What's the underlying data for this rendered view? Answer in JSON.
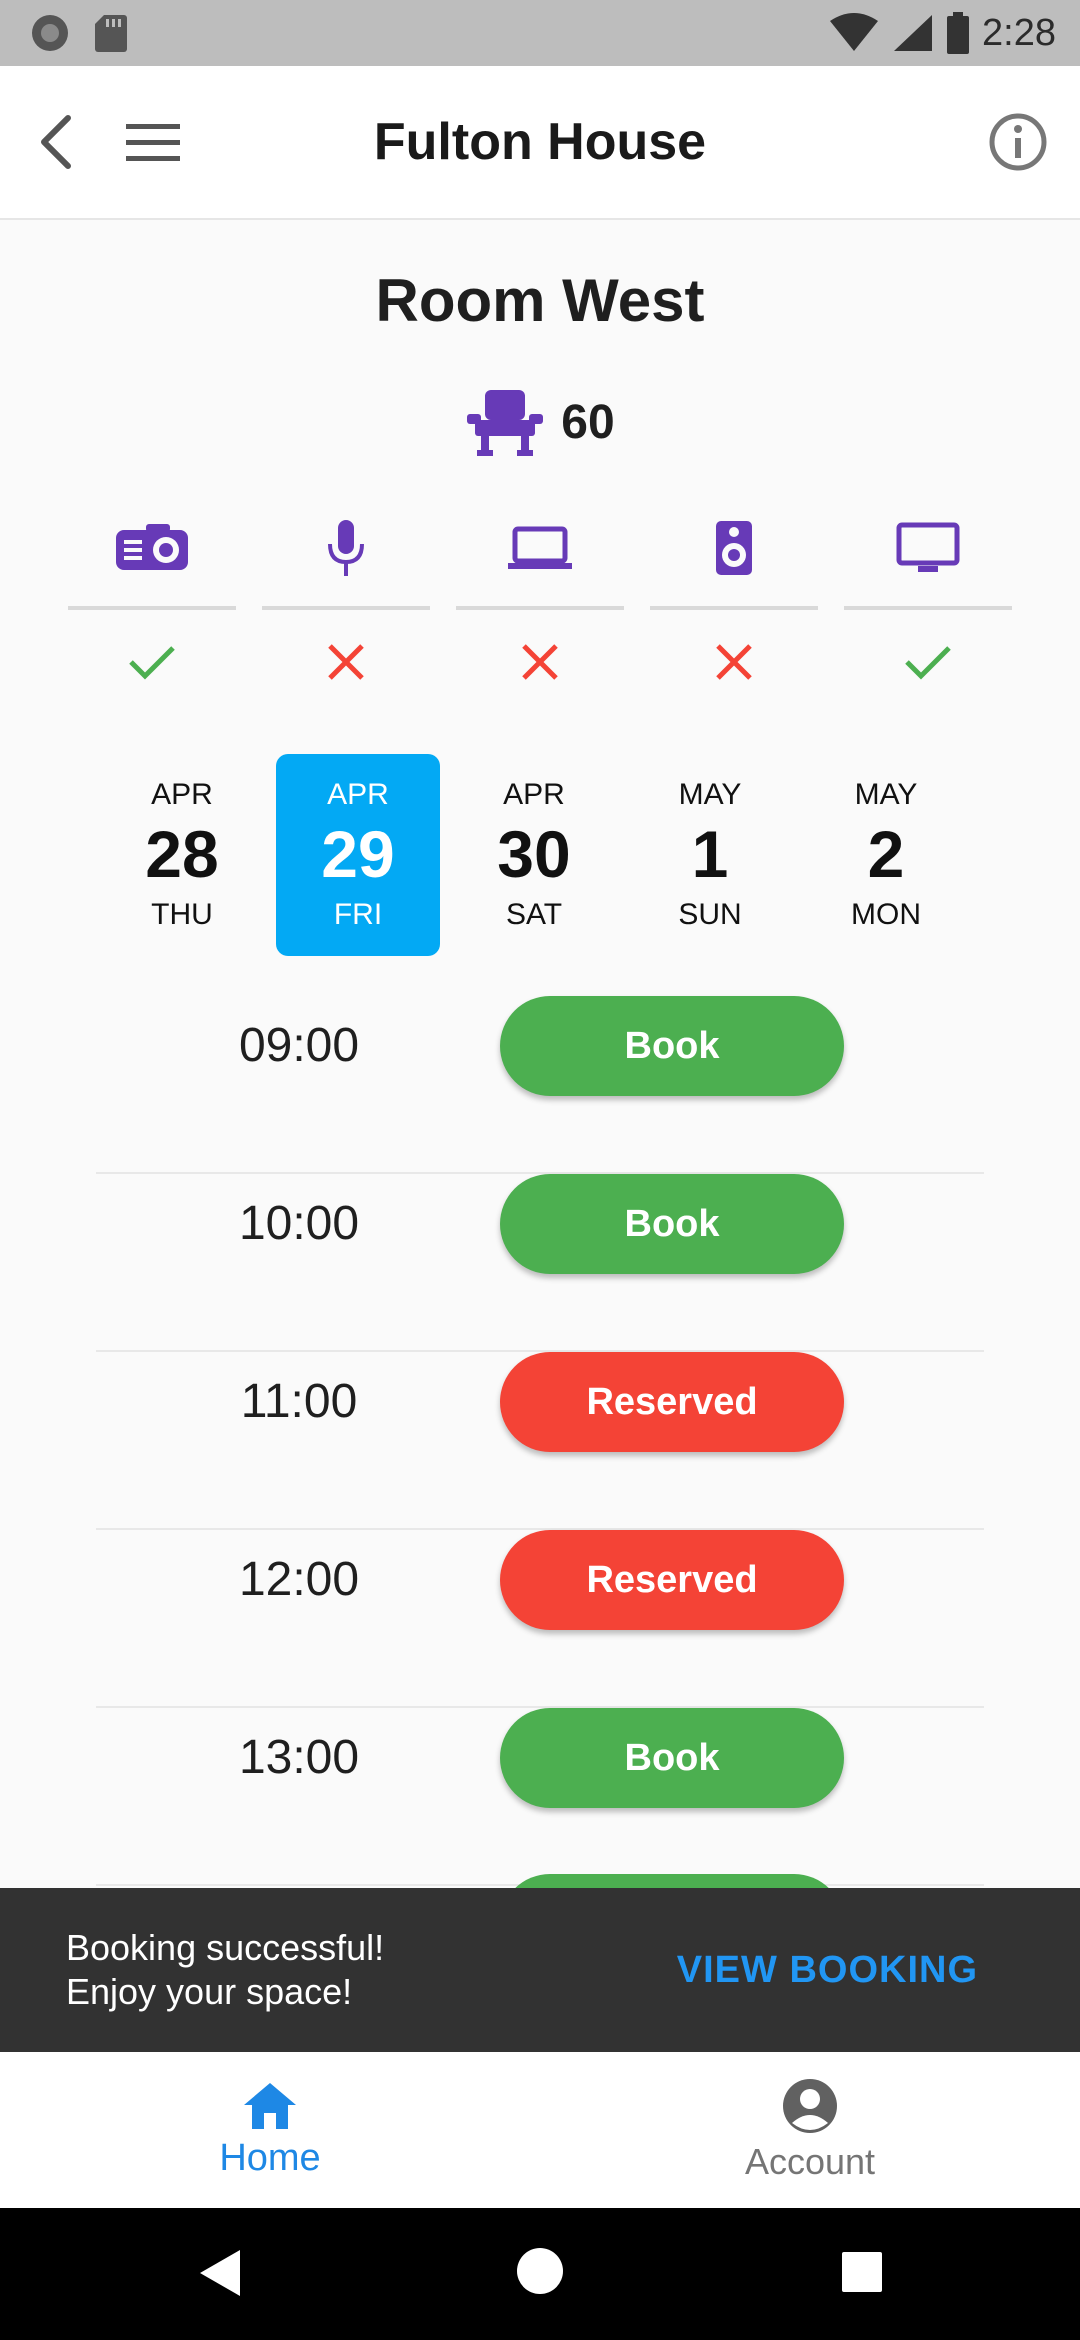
{
  "status_bar": {
    "time": "2:28"
  },
  "app_bar": {
    "title": "Fulton House"
  },
  "room": {
    "name": "Room West",
    "capacity": "60"
  },
  "amenities": [
    {
      "icon": "projector-icon",
      "available": true
    },
    {
      "icon": "microphone-icon",
      "available": false
    },
    {
      "icon": "laptop-icon",
      "available": false
    },
    {
      "icon": "speaker-icon",
      "available": false
    },
    {
      "icon": "monitor-icon",
      "available": true
    }
  ],
  "dates": [
    {
      "month": "APR",
      "day": "28",
      "weekday": "THU",
      "selected": false
    },
    {
      "month": "APR",
      "day": "29",
      "weekday": "FRI",
      "selected": true
    },
    {
      "month": "APR",
      "day": "30",
      "weekday": "SAT",
      "selected": false
    },
    {
      "month": "MAY",
      "day": "1",
      "weekday": "SUN",
      "selected": false
    },
    {
      "month": "MAY",
      "day": "2",
      "weekday": "MON",
      "selected": false
    }
  ],
  "slots": [
    {
      "time": "09:00",
      "label": "Book",
      "status": "book"
    },
    {
      "time": "10:00",
      "label": "Book",
      "status": "book"
    },
    {
      "time": "11:00",
      "label": "Reserved",
      "status": "reserved"
    },
    {
      "time": "12:00",
      "label": "Reserved",
      "status": "reserved"
    },
    {
      "time": "13:00",
      "label": "Book",
      "status": "book"
    }
  ],
  "snackbar": {
    "line1": "Booking successful!",
    "line2": "Enjoy your space!",
    "action": "VIEW BOOKING"
  },
  "bottom_nav": {
    "home": "Home",
    "account": "Account"
  },
  "colors": {
    "accent": "#03a9f4",
    "book": "#4caf50",
    "reserved": "#f44336",
    "amenity": "#673ab7",
    "nav_active": "#1e88e5"
  }
}
